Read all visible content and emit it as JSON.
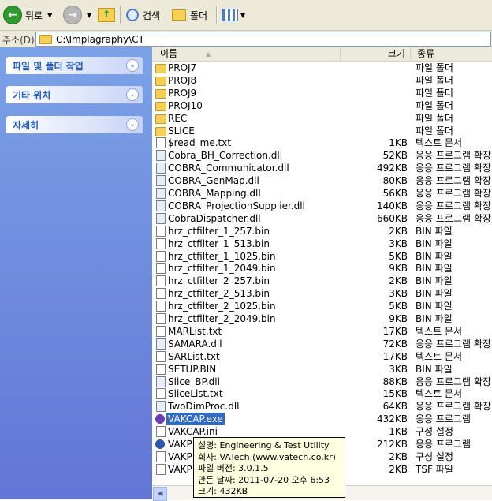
{
  "toolbar": {
    "back_label": "뒤로",
    "search_label": "검색",
    "folders_label": "폴더"
  },
  "address": {
    "label": "주소(D)",
    "path": "C:\\Implagraphy\\CT"
  },
  "tasks": [
    {
      "label": "파일 및 폴더 작업"
    },
    {
      "label": "기타 위치"
    },
    {
      "label": "자세히"
    }
  ],
  "columns": {
    "name": "이름",
    "size": "크기",
    "type": "종류"
  },
  "files": [
    {
      "name": "PROJ7",
      "size": "",
      "type": "파일 폴더",
      "icon": "folder"
    },
    {
      "name": "PROJ8",
      "size": "",
      "type": "파일 폴더",
      "icon": "folder"
    },
    {
      "name": "PROJ9",
      "size": "",
      "type": "파일 폴더",
      "icon": "folder"
    },
    {
      "name": "PROJ10",
      "size": "",
      "type": "파일 폴더",
      "icon": "folder"
    },
    {
      "name": "REC",
      "size": "",
      "type": "파일 폴더",
      "icon": "folder"
    },
    {
      "name": "SLICE",
      "size": "",
      "type": "파일 폴더",
      "icon": "folder"
    },
    {
      "name": "$read_me.txt",
      "size": "1KB",
      "type": "텍스트 문서",
      "icon": "file"
    },
    {
      "name": "Cobra_BH_Correction.dll",
      "size": "52KB",
      "type": "응용 프로그램 확장",
      "icon": "dll"
    },
    {
      "name": "COBRA_Communicator.dll",
      "size": "492KB",
      "type": "응용 프로그램 확장",
      "icon": "dll"
    },
    {
      "name": "COBRA_GenMap.dll",
      "size": "80KB",
      "type": "응용 프로그램 확장",
      "icon": "dll"
    },
    {
      "name": "COBRA_Mapping.dll",
      "size": "56KB",
      "type": "응용 프로그램 확장",
      "icon": "dll"
    },
    {
      "name": "COBRA_ProjectionSupplier.dll",
      "size": "140KB",
      "type": "응용 프로그램 확장",
      "icon": "dll"
    },
    {
      "name": "CobraDispatcher.dll",
      "size": "660KB",
      "type": "응용 프로그램 확장",
      "icon": "dll"
    },
    {
      "name": "hrz_ctfilter_1_257.bin",
      "size": "2KB",
      "type": "BIN 파일",
      "icon": "file"
    },
    {
      "name": "hrz_ctfilter_1_513.bin",
      "size": "3KB",
      "type": "BIN 파일",
      "icon": "file"
    },
    {
      "name": "hrz_ctfilter_1_1025.bin",
      "size": "5KB",
      "type": "BIN 파일",
      "icon": "file"
    },
    {
      "name": "hrz_ctfilter_1_2049.bin",
      "size": "9KB",
      "type": "BIN 파일",
      "icon": "file"
    },
    {
      "name": "hrz_ctfilter_2_257.bin",
      "size": "2KB",
      "type": "BIN 파일",
      "icon": "file"
    },
    {
      "name": "hrz_ctfilter_2_513.bin",
      "size": "3KB",
      "type": "BIN 파일",
      "icon": "file"
    },
    {
      "name": "hrz_ctfilter_2_1025.bin",
      "size": "5KB",
      "type": "BIN 파일",
      "icon": "file"
    },
    {
      "name": "hrz_ctfilter_2_2049.bin",
      "size": "9KB",
      "type": "BIN 파일",
      "icon": "file"
    },
    {
      "name": "MARList.txt",
      "size": "17KB",
      "type": "텍스트 문서",
      "icon": "file"
    },
    {
      "name": "SAMARA.dll",
      "size": "72KB",
      "type": "응용 프로그램 확장",
      "icon": "dll"
    },
    {
      "name": "SARList.txt",
      "size": "17KB",
      "type": "텍스트 문서",
      "icon": "file"
    },
    {
      "name": "SETUP.BIN",
      "size": "3KB",
      "type": "BIN 파일",
      "icon": "file"
    },
    {
      "name": "Slice_BP.dll",
      "size": "88KB",
      "type": "응용 프로그램 확장",
      "icon": "dll"
    },
    {
      "name": "SliceList.txt",
      "size": "15KB",
      "type": "텍스트 문서",
      "icon": "file"
    },
    {
      "name": "TwoDimProc.dll",
      "size": "64KB",
      "type": "응용 프로그램 확장",
      "icon": "dll"
    },
    {
      "name": "VAKCAP.exe",
      "size": "432KB",
      "type": "응용 프로그램",
      "icon": "exe",
      "selected": true
    },
    {
      "name": "VAKCAP.ini",
      "size": "1KB",
      "type": "구성 설정",
      "icon": "file"
    },
    {
      "name": "VAKP",
      "size": "212KB",
      "type": "응용 프로그램",
      "icon": "exe2"
    },
    {
      "name": "VAKP",
      "size": "2KB",
      "type": "구성 설정",
      "icon": "file"
    },
    {
      "name": "VAKP",
      "size": "2KB",
      "type": "TSF 파일",
      "icon": "file"
    }
  ],
  "tooltip": {
    "line1": "설명: Engineering & Test Utility",
    "line2": "회사: VATech (www.vatech.co.kr)",
    "line3": "파일 버전: 3.0.1.5",
    "line4": "만든 날짜: 2011-07-20 오후 6:53",
    "line5": "크기: 432KB"
  }
}
